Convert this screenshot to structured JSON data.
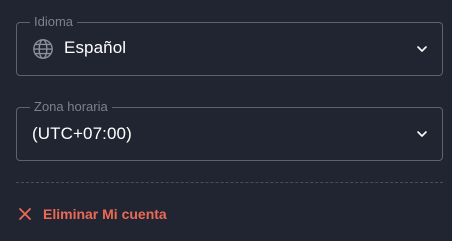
{
  "language": {
    "label": "Idioma",
    "value": "Español",
    "icon": "globe-icon"
  },
  "timezone": {
    "label": "Zona horaria",
    "value": "(UTC+07:00)"
  },
  "delete_account": {
    "label": "Eliminar Mi cuenta",
    "icon": "close-icon",
    "color": "#ec6a55"
  },
  "colors": {
    "background": "#212532",
    "border": "#5d6170",
    "text": "#ffffff",
    "muted": "#7c8090"
  }
}
